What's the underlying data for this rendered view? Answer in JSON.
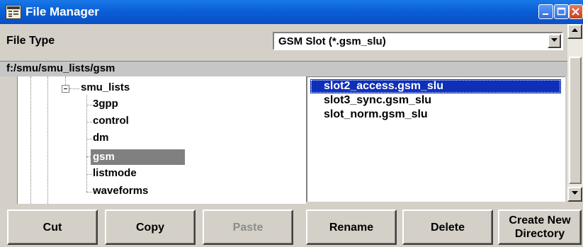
{
  "window": {
    "title": "File Manager",
    "controls": [
      "minimize-icon",
      "maximize-icon",
      "close-icon"
    ]
  },
  "file_type": {
    "label": "File Type",
    "selected": "GSM Slot (*.gsm_slu)"
  },
  "path": "f:/smu/smu_lists/gsm",
  "tree": {
    "parent": "smu_lists",
    "children": [
      "3gpp",
      "control",
      "dm",
      "gsm",
      "listmode",
      "waveforms"
    ],
    "selected": "gsm"
  },
  "files": {
    "items": [
      "slot2_access.gsm_slu",
      "slot3_sync.gsm_slu",
      "slot_norm.gsm_slu"
    ],
    "selected": "slot2_access.gsm_slu"
  },
  "buttons": {
    "cut": "Cut",
    "copy": "Copy",
    "paste": "Paste",
    "rename": "Rename",
    "delete": "Delete",
    "create_dir_line1": "Create New",
    "create_dir_line2": "Directory"
  },
  "colors": {
    "titlebar": "#0a5fd8",
    "selection": "#0e2fb8",
    "tree_selection": "#808080",
    "dialog_bg": "#d4d0c8"
  }
}
